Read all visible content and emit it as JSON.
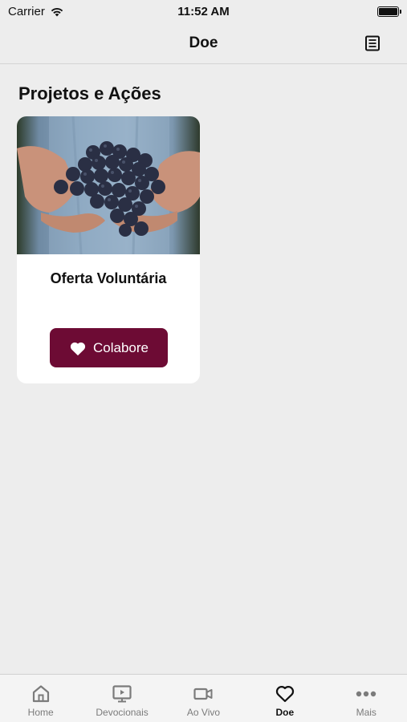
{
  "status": {
    "carrier": "Carrier",
    "time": "11:52 AM"
  },
  "header": {
    "title": "Doe",
    "action_icon": "list-document-icon"
  },
  "section": {
    "title": "Projetos e Ações"
  },
  "card": {
    "image_icon": "grapes-in-hands-photo",
    "title": "Oferta Voluntária",
    "button_label": "Colabore",
    "button_icon": "heart-icon"
  },
  "colors": {
    "accent": "#6d0b34",
    "background": "#ededed"
  },
  "tabs": [
    {
      "label": "Home",
      "icon": "home-icon",
      "active": false
    },
    {
      "label": "Devocionais",
      "icon": "monitor-play-icon",
      "active": false
    },
    {
      "label": "Ao Vivo",
      "icon": "video-camera-icon",
      "active": false
    },
    {
      "label": "Doe",
      "icon": "heart-icon",
      "active": true
    },
    {
      "label": "Mais",
      "icon": "more-dots-icon",
      "active": false
    }
  ]
}
